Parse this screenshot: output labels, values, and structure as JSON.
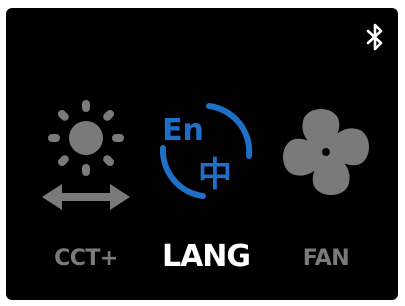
{
  "device_menu": {
    "status_icons": [
      "bluetooth-icon"
    ],
    "colors": {
      "background": "#000000",
      "inactive": "#7a7a7a",
      "selected_label": "#ffffff",
      "accent": "#1f6fc9"
    },
    "items": [
      {
        "label": "CCT+",
        "icon": "sun-brightness-icon",
        "selected": false
      },
      {
        "label": "LANG",
        "icon": "language-icon",
        "selected": true,
        "icon_text": [
          "En",
          "中"
        ]
      },
      {
        "label": "FAN",
        "icon": "fan-icon",
        "selected": false
      }
    ]
  }
}
